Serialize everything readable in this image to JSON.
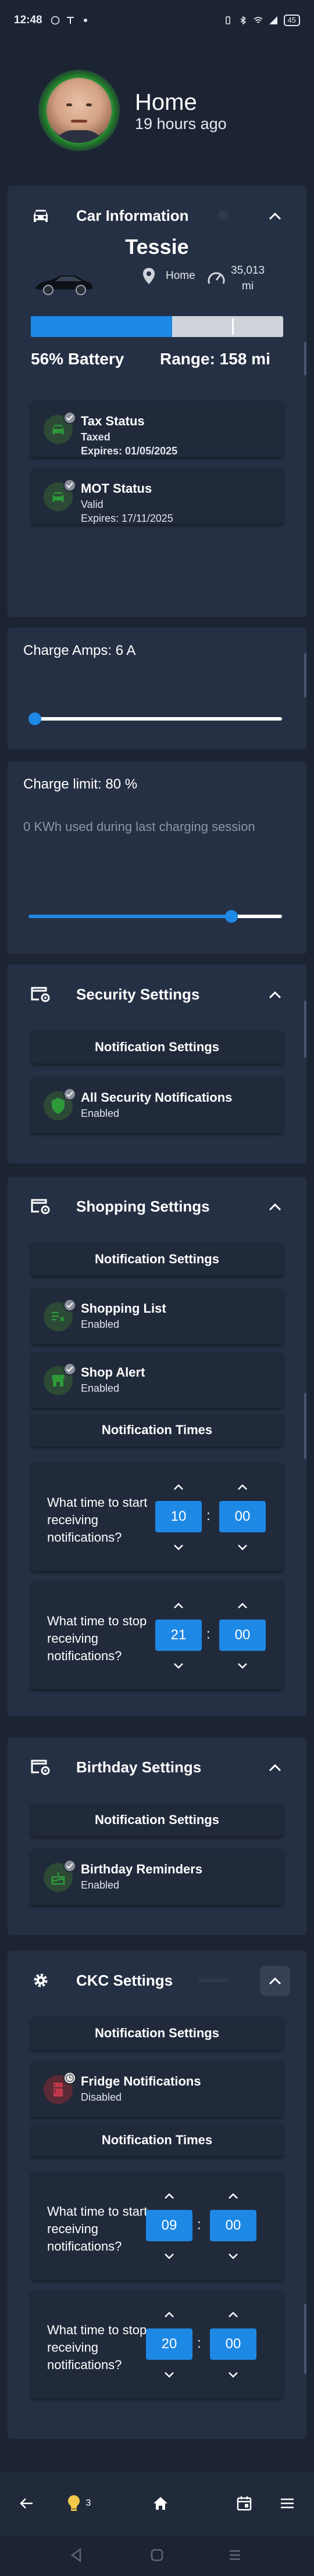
{
  "status_bar": {
    "time": "12:48",
    "battery": "45"
  },
  "header": {
    "title": "Home",
    "subtitle": "19 hours ago"
  },
  "car": {
    "title": "Car Information",
    "name": "Tessie",
    "location": "Home",
    "odometer_value": "35,013",
    "odometer_unit": "mi",
    "battery_percent": 56,
    "battery_charge_limit_percent": 80,
    "battery_label": "56% Battery",
    "range_label": "Range: 158 mi",
    "tax": {
      "title": "Tax Status",
      "status": "Taxed",
      "expires": "Expires: 01/05/2025"
    },
    "mot": {
      "title": "MOT Status",
      "status": "Valid",
      "expires": "Expires: 17/11/2025"
    }
  },
  "charge_amps": {
    "label": "Charge Amps: 6 A",
    "value_fraction": 0.0
  },
  "charge_limit": {
    "label": "Charge limit: 80 %",
    "sub": "0 KWh used during last charging session",
    "value_fraction": 0.8
  },
  "security": {
    "title": "Security Settings",
    "notification_settings_label": "Notification Settings",
    "items": [
      {
        "title": "All Security Notifications",
        "status": "Enabled"
      }
    ]
  },
  "shopping": {
    "title": "Shopping Settings",
    "notification_settings_label": "Notification Settings",
    "items": [
      {
        "title": "Shopping List",
        "status": "Enabled"
      },
      {
        "title": "Shop Alert",
        "status": "Enabled"
      }
    ],
    "notification_times_label": "Notification Times",
    "start": {
      "label": "What time to start receiving notifications?",
      "hour": "10",
      "minute": "00"
    },
    "stop": {
      "label": "What time to stop receiving notifications?",
      "hour": "21",
      "minute": "00"
    }
  },
  "birthday": {
    "title": "Birthday Settings",
    "notification_settings_label": "Notification Settings",
    "items": [
      {
        "title": "Birthday Reminders",
        "status": "Enabled"
      }
    ]
  },
  "ckc": {
    "title": "CKC Settings",
    "notification_settings_label": "Notification Settings",
    "items": [
      {
        "title": "Fridge Notifications",
        "status": "Disabled"
      }
    ],
    "notification_times_label": "Notification Times",
    "start": {
      "label": "What time to start receiving notifications?",
      "hour": "09",
      "minute": "00"
    },
    "stop": {
      "label": "What time to stop receiving notifications?",
      "hour": "20",
      "minute": "00"
    }
  },
  "bottom_nav": {
    "tips_count": "3"
  },
  "colors": {
    "background": "#1c2433",
    "card": "#263044",
    "accent": "#1e88e5",
    "enabled_green": "#2e9a3a",
    "disabled_red": "#c0394b"
  }
}
